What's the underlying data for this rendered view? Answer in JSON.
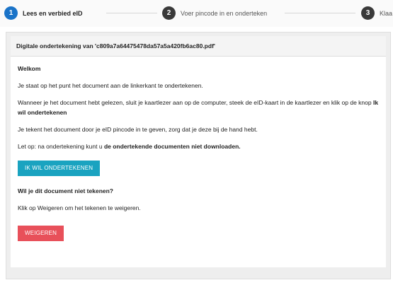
{
  "steps": [
    {
      "number": "1",
      "label": "Lees en verbied eID",
      "state": "active"
    },
    {
      "number": "2",
      "label": "Voer pincode in en onderteken",
      "state": "inactive"
    },
    {
      "number": "3",
      "label": "Klaa",
      "state": "inactive"
    }
  ],
  "panel": {
    "title": "Digitale ondertekening van 'c809a7a64475478da57a5a420fb6ac80.pdf'",
    "heading": "Welkom",
    "p1": "Je staat op het punt het document aan de linkerkant te ondertekenen.",
    "p2_prefix": "Wanneer je het document hebt gelezen, sluit je kaartlezer aan op de computer, steek de eID-kaart in de kaartlezer en klik op de knop ",
    "p2_bold": "Ik wil ondertekenen",
    "p3": "Je tekent het document door je eID pincode in te geven, zorg dat je deze bij de hand hebt.",
    "p4_prefix": "Let op: na ondertekening kunt u ",
    "p4_bold": "de ondertekende documenten niet downloaden.",
    "sign_button": "Ik wil ondertekenen",
    "refuse_title": "Wil je dit document niet tekenen?",
    "refuse_text": "Klik op Weigeren om het tekenen te weigeren.",
    "refuse_button": "Weigeren"
  },
  "colors": {
    "active_step": "#1a73c8",
    "inactive_step": "#3a3a3a",
    "sign_button": "#1aa3c0",
    "refuse_button": "#e8505a"
  }
}
